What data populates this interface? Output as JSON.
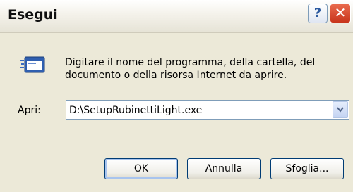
{
  "window": {
    "title": "Esegui"
  },
  "titlebar": {
    "help_label": "?",
    "close_label": "✕"
  },
  "dialog": {
    "description": "Digitare il nome del programma, della cartella, del documento o della risorsa Internet da aprire.",
    "open_label": "Apri:",
    "open_value": "D:\\SetupRubinettiLight.exe"
  },
  "buttons": {
    "ok": "OK",
    "cancel": "Annulla",
    "browse": "Sfoglia..."
  },
  "icons": {
    "run": "run-dialog-icon",
    "dropdown": "chevron-down-icon"
  },
  "colors": {
    "dialog_bg": "#ece9d8",
    "close_red": "#c8351c",
    "border_blue": "#7f9db9"
  }
}
